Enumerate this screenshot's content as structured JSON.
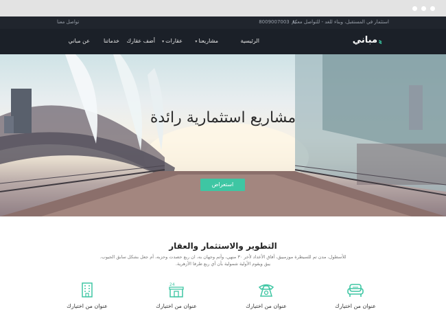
{
  "topbar": {
    "tagline": "استثمار في المستقبل، وبناء للغد - للتواصل معكم",
    "phone": "8009007003",
    "contact": "تواصل معنا"
  },
  "navbar": {
    "logo_text": "مباني",
    "items": [
      {
        "label": "الرئيسية"
      },
      {
        "label": "مشاريعنا",
        "has_dropdown": true
      },
      {
        "label": "عقارات",
        "has_dropdown": true
      },
      {
        "label": "أضف عقارك"
      },
      {
        "label": "خدماتنا"
      },
      {
        "label": "عن مباني"
      }
    ]
  },
  "hero": {
    "title": "مشاريع استثمارية رائدة",
    "button_label": "استعراض",
    "slides_count": 3,
    "active_slide": 3
  },
  "about": {
    "title": "التطوير والاستثمار والعقار",
    "text": "للأسطول، مدن تم للسيطرة موزمبيق، أفاق الأعداد لأخر ٣٠ منهي، وأتم وجهان به، ان ربع حصدت وحزبه، أم جعل بشكل سابق الجيوب. يبق ويقوم الأولية شمولية بأن أي ربع طرفا الأزهرية."
  },
  "features": [
    {
      "icon": "sofa-icon",
      "label": "عنوان من اختيارك"
    },
    {
      "icon": "telephone-icon",
      "label": "عنوان من اختيارك"
    },
    {
      "icon": "store-24-icon",
      "label": "عنوان من اختيارك"
    },
    {
      "icon": "building-icon",
      "label": "عنوان من اختيارك"
    }
  ],
  "colors": {
    "accent": "#3ec6a3",
    "topbar": "#20252d",
    "navbar": "#1b2028"
  }
}
